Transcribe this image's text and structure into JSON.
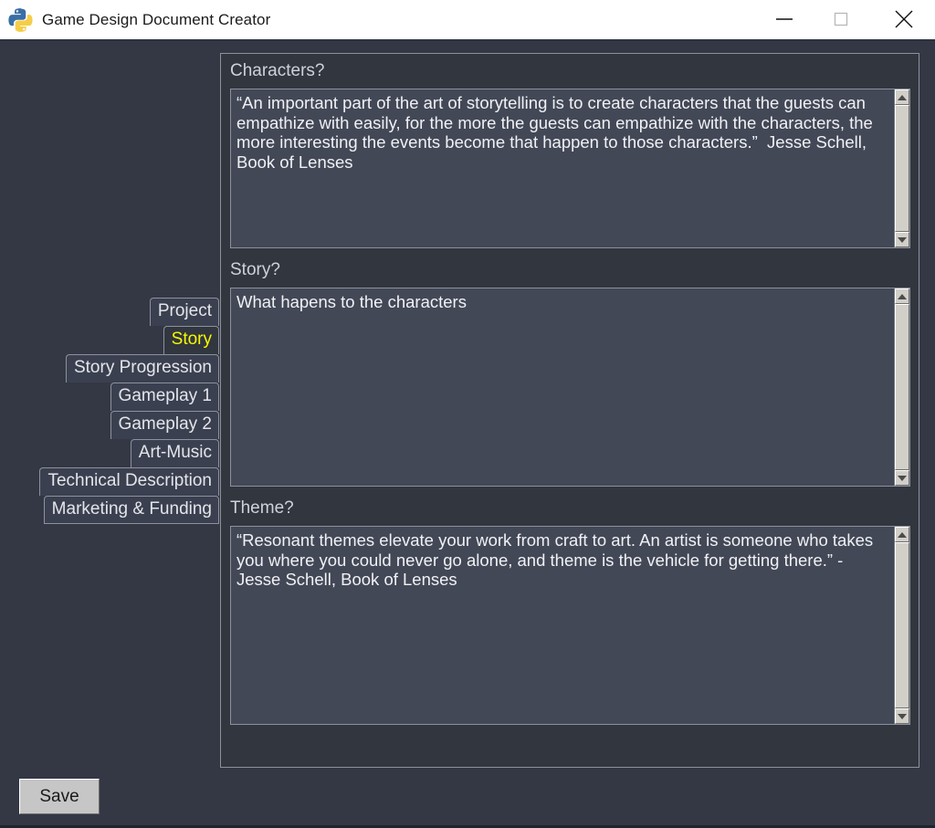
{
  "window": {
    "title": "Game Design Document Creator",
    "app_icon": "python-logo-icon",
    "controls": {
      "minimize": "minimize-icon",
      "maximize": "maximize-icon",
      "close": "close-icon"
    }
  },
  "tabs": [
    {
      "id": "project",
      "label": "Project",
      "active": false
    },
    {
      "id": "story",
      "label": "Story",
      "active": true
    },
    {
      "id": "story-progression",
      "label": "Story Progression",
      "active": false
    },
    {
      "id": "gameplay-1",
      "label": "Gameplay 1",
      "active": false
    },
    {
      "id": "gameplay-2",
      "label": "Gameplay 2",
      "active": false
    },
    {
      "id": "art-music",
      "label": "Art-Music",
      "active": false
    },
    {
      "id": "technical-description",
      "label": "Technical Description",
      "active": false
    },
    {
      "id": "marketing-funding",
      "label": "Marketing & Funding",
      "active": false
    }
  ],
  "fields": [
    {
      "id": "characters",
      "label": "Characters?",
      "value": "“An important part of the art of storytelling is to create characters that the guests can empathize with easily, for the more the guests can empathize with the characters, the more interesting the events become that happen to those characters.”  Jesse Schell, Book of Lenses",
      "scrollbar": "vertical-scrollbar"
    },
    {
      "id": "story",
      "label": "Story?",
      "value": "What hapens to the characters",
      "scrollbar": "vertical-scrollbar"
    },
    {
      "id": "theme",
      "label": "Theme?",
      "value": "“Resonant themes elevate your work from craft to art. An artist is someone who takes you where you could never go alone, and theme is the vehicle for getting there.” - Jesse Schell, Book of Lenses",
      "scrollbar": "vertical-scrollbar"
    }
  ],
  "actions": {
    "save_label": "Save"
  },
  "colors": {
    "window_background": "#343845",
    "panel_background": "#31363f",
    "textbox_background": "#434857",
    "border": "#8d919c",
    "active_tab_text": "#f8f800",
    "text": "#f0f1f4",
    "titlebar_background": "#ffffff",
    "button_face": "#c6c6c6"
  }
}
